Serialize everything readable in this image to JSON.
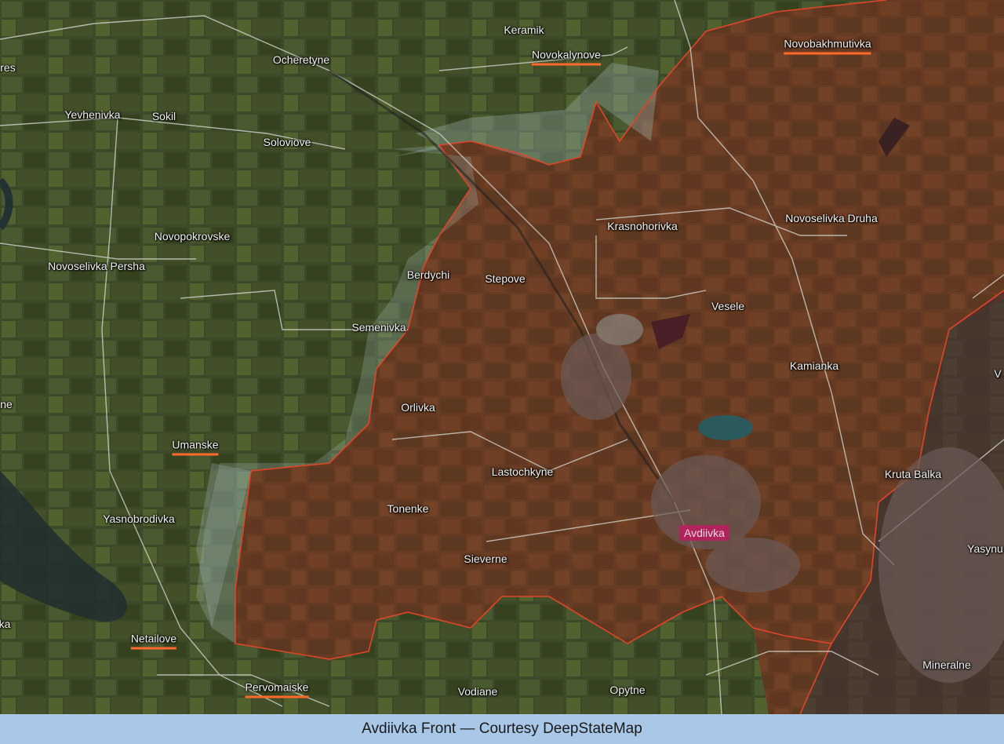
{
  "caption": "Avdiivka Front — Courtesy DeepStateMap",
  "colors": {
    "occupied_fill": "#8a3a22",
    "front_line": "#e0452a",
    "gray_zone": "#9fb7b3",
    "highlight_bg": "#b0245e",
    "underline": "#ff6a2a",
    "caption_bg": "#a9c8e8"
  },
  "places": {
    "keramik": "Keramik",
    "novokalynove": "Novokalynove",
    "novobakhmutivka": "Novobakhmutivka",
    "ocheretyne": "Ocheretyne",
    "yevhenivka": "Yevhenivka",
    "sokil": "Sokil",
    "soloviove": "Soloviove",
    "novopokrovske": "Novopokrovske",
    "novoselivka_persha": "Novoselivka Persha",
    "berdychi": "Berdychi",
    "stepove": "Stepove",
    "krasnohorivka": "Krasnohorivka",
    "novoselivka_druha": "Novoselivka Druha",
    "vesele": "Vesele",
    "semenivka": "Semenivka",
    "kamianka": "Kamianka",
    "orlivka": "Orlivka",
    "umanske": "Umanske",
    "lastochkyne": "Lastochkyne",
    "kruta_balka": "Kruta Balka",
    "tonenke": "Tonenke",
    "yasnobrodivka": "Yasnobrodivka",
    "avdiivka": "Avdiivka",
    "sieverne": "Sieverne",
    "yasynuvata": "Yasynu",
    "netailove": "Netailove",
    "mineralne": "Mineralne",
    "pervomaiske": "Pervomaiske",
    "vodiane": "Vodiane",
    "opytne": "Opytne",
    "edge_res": "res",
    "edge_ne": "ne",
    "edge_ka": "ka",
    "edge_v": "V"
  }
}
